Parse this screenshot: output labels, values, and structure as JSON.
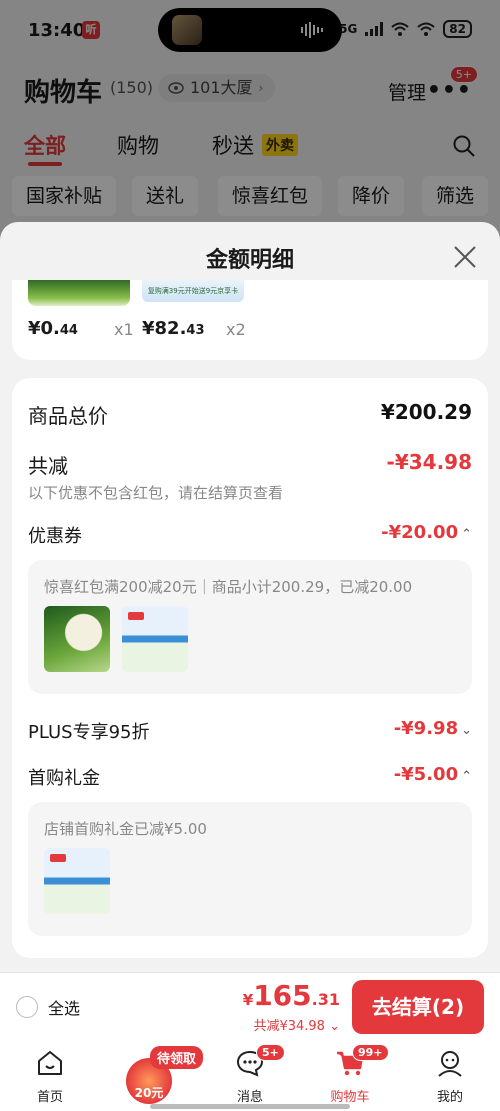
{
  "status_bar": {
    "time": "13:40",
    "app_badge": "听",
    "network": "5G",
    "battery": "82"
  },
  "cart": {
    "title": "购物车",
    "count": "(150)",
    "address": "101大厦",
    "manage": "管理",
    "more_badge": "5+"
  },
  "tabs": [
    {
      "label": "全部"
    },
    {
      "label": "购物"
    },
    {
      "label": "秒送"
    }
  ],
  "waimai_tag": "外卖",
  "filter_chips": [
    "国家补贴",
    "送礼",
    "惊喜红包",
    "降价",
    "筛选"
  ],
  "sheet": {
    "title": "金额明细",
    "items": [
      {
        "price_int": "¥0.",
        "price_dec": "44",
        "qty": "x1"
      },
      {
        "price_int": "¥82.",
        "price_dec": "43",
        "qty": "x2"
      }
    ],
    "item2_banner": "复购满39元开始送9元京享卡",
    "subtotal": {
      "label": "商品总价",
      "value": "¥200.29"
    },
    "discount": {
      "label": "共减",
      "value": "-¥34.98",
      "note": "以下优惠不包含红包，请在结算页查看"
    },
    "coupon": {
      "label": "优惠券",
      "value": "-¥20.00",
      "detail": "惊喜红包满200减20元｜商品小计200.29，已减20.00",
      "expanded": true
    },
    "plus": {
      "label": "PLUS专享95折",
      "value": "-¥9.98",
      "expanded": false
    },
    "first_gift": {
      "label": "首购礼金",
      "value": "-¥5.00",
      "detail": "店铺首购礼金已减¥5.00",
      "expanded": true
    }
  },
  "checkout": {
    "select_all": "全选",
    "total_yen": "¥",
    "total_int": "165",
    "total_dec": ".31",
    "total_discount": "共减¥34.98",
    "button": "去结算(2)"
  },
  "tabbar": [
    {
      "label": "首页",
      "icon": "home-icon"
    },
    {
      "label": "消息",
      "icon": "message-icon",
      "badge": "5+"
    },
    {
      "label": "购物车",
      "icon": "cart-icon",
      "badge": "99+",
      "active": true
    },
    {
      "label": "我的",
      "icon": "profile-icon"
    }
  ],
  "promo": {
    "pill": "待领取",
    "coin": "20元"
  },
  "colors": {
    "accent": "#e4393c",
    "waimai": "#ffd31a"
  }
}
